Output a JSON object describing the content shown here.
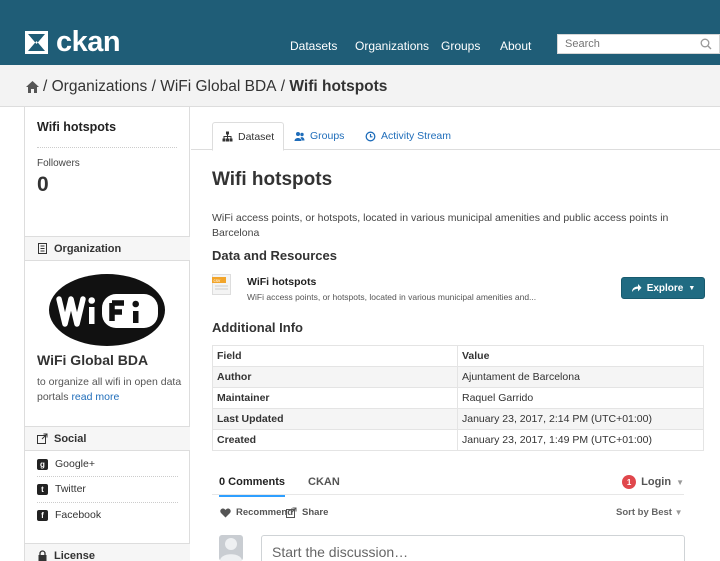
{
  "app": {
    "logo_text": "ckan"
  },
  "nav": {
    "items": [
      "Datasets",
      "Organizations",
      "Groups",
      "About"
    ]
  },
  "search": {
    "placeholder": "Search"
  },
  "breadcrumb": {
    "org": "Organizations",
    "sep": "/",
    "org_name": "WiFi Global BDA",
    "current": "Wifi hotspots"
  },
  "sidebar": {
    "title": "Wifi hotspots",
    "followers_label": "Followers",
    "followers_count": "0",
    "organization_heading": "Organization",
    "org_name": "WiFi Global BDA",
    "org_description": "to organize all wifi in open data portals",
    "read_more": "read more",
    "social_heading": "Social",
    "social": [
      "Google+",
      "Twitter",
      "Facebook"
    ],
    "license_heading": "License"
  },
  "tabs": [
    "Dataset",
    "Groups",
    "Activity Stream"
  ],
  "dataset": {
    "title": "Wifi hotspots",
    "description": "WiFi access points, or hotspots, located in various municipal amenities and public access points in Barcelona",
    "resources_heading": "Data and Resources",
    "resource": {
      "format_badge": "csv",
      "name": "WiFi hotspots",
      "description": "WiFi access points, or hotspots, located in various municipal amenities and...",
      "explore_label": "Explore"
    },
    "additional_info_heading": "Additional Info",
    "table": {
      "headers": [
        "Field",
        "Value"
      ],
      "rows": [
        [
          "Author",
          "Ajuntament de Barcelona"
        ],
        [
          "Maintainer",
          "Raquel Garrido"
        ],
        [
          "Last Updated",
          "January 23, 2017, 2:14 PM (UTC+01:00)"
        ],
        [
          "Created",
          "January 23, 2017, 1:49 PM (UTC+01:00)"
        ]
      ]
    }
  },
  "comments": {
    "tab_comments": "0 Comments",
    "tab_ckan": "CKAN",
    "login_badge": "1",
    "login_label": "Login",
    "recommend": "Recommend",
    "share": "Share",
    "sort_by": "Sort by Best",
    "placeholder": "Start the discussion…"
  },
  "colors": {
    "topbar": "#1f5d77",
    "accent": "#206b82",
    "link": "#1f6dba",
    "badge": "#e0474c"
  }
}
